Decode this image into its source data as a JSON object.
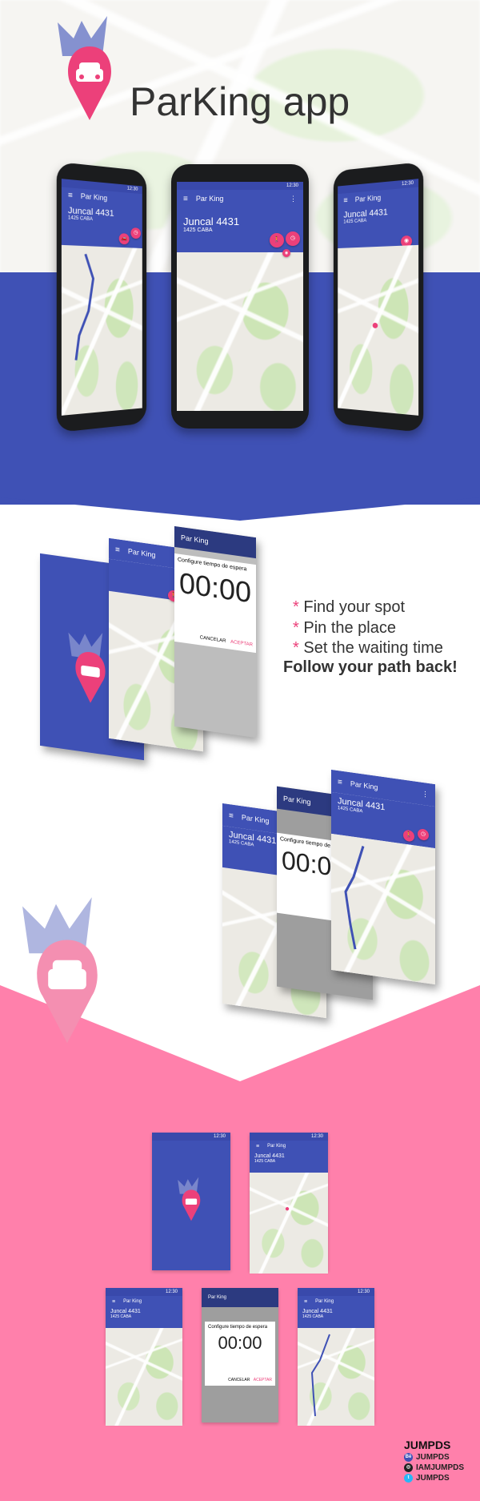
{
  "header": {
    "app_title": "ParKing app",
    "logo_icon": "crowned-car-pin-icon"
  },
  "phone_ui": {
    "toolbar_title": "Par King",
    "status_time": "12:30",
    "address_line1": "Juncal 4431",
    "address_line2": "1425 CABA",
    "dialog_title": "Configure tiempo de espera",
    "timer_value": "00:00",
    "cancel_label": "CANCELAR",
    "accept_label": "ACEPTAR"
  },
  "features": {
    "items": [
      {
        "bullet": "*",
        "text": "Find your spot"
      },
      {
        "bullet": "*",
        "text": "Pin the place"
      },
      {
        "bullet": "*",
        "text": "Set the waiting time"
      }
    ],
    "tagline": "Follow your path back!"
  },
  "footer": {
    "brand": "JUMPDS",
    "socials": [
      {
        "icon": "behance-icon",
        "glyph": "Bē",
        "handle": "JUMPDS"
      },
      {
        "icon": "instagram-icon",
        "glyph": "◎",
        "handle": "IAMJUMPDS"
      },
      {
        "icon": "twitter-icon",
        "glyph": "t",
        "handle": "JUMPDS"
      }
    ]
  },
  "colors": {
    "primary": "#3f51b5",
    "accent": "#ec407a",
    "pink_bg": "#ff80ab"
  }
}
